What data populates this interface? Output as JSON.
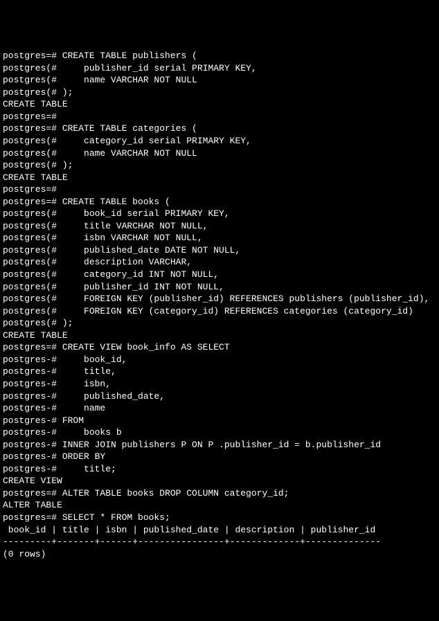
{
  "lines": [
    "postgres=# CREATE TABLE publishers (",
    "postgres(#     publisher_id serial PRIMARY KEY,",
    "postgres(#     name VARCHAR NOT NULL",
    "postgres(# );",
    "CREATE TABLE",
    "postgres=#",
    "postgres=# CREATE TABLE categories (",
    "postgres(#     category_id serial PRIMARY KEY,",
    "postgres(#     name VARCHAR NOT NULL",
    "postgres(# );",
    "CREATE TABLE",
    "postgres=#",
    "postgres=# CREATE TABLE books (",
    "postgres(#     book_id serial PRIMARY KEY,",
    "postgres(#     title VARCHAR NOT NULL,",
    "postgres(#     isbn VARCHAR NOT NULL,",
    "postgres(#     published_date DATE NOT NULL,",
    "postgres(#     description VARCHAR,",
    "postgres(#     category_id INT NOT NULL,",
    "postgres(#     publisher_id INT NOT NULL,",
    "postgres(#     FOREIGN KEY (publisher_id) REFERENCES publishers (publisher_id),",
    "postgres(#     FOREIGN KEY (category_id) REFERENCES categories (category_id)",
    "postgres(# );",
    "CREATE TABLE",
    "postgres=# CREATE VIEW book_info AS SELECT",
    "postgres-#     book_id,",
    "postgres-#     title,",
    "postgres-#     isbn,",
    "postgres-#     published_date,",
    "postgres-#     name",
    "postgres-# FROM",
    "postgres-#     books b",
    "postgres-# INNER JOIN publishers P ON P .publisher_id = b.publisher_id",
    "postgres-# ORDER BY",
    "postgres-#     title;",
    "CREATE VIEW",
    "postgres=# ALTER TABLE books DROP COLUMN category_id;",
    "ALTER TABLE",
    "postgres=# SELECT * FROM books;",
    " book_id | title | isbn | published_date | description | publisher_id",
    "---------+-------+------+----------------+-------------+--------------",
    "(0 rows)"
  ]
}
